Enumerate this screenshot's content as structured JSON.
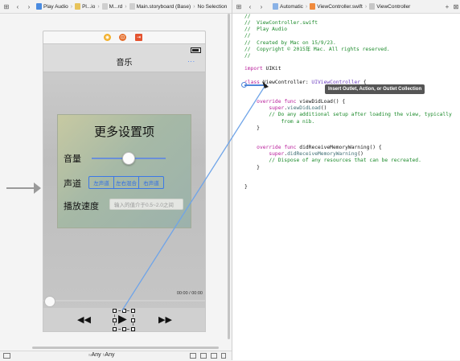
{
  "left_jumpbar": {
    "crumbs": [
      "Play Audio",
      "Pl...io",
      "M...rd",
      "Main.storyboard (Base)",
      "No Selection"
    ]
  },
  "right_jumpbar": {
    "crumbs": [
      "Automatic",
      "ViewController.swift",
      "ViewController"
    ]
  },
  "scene": {
    "nav_title": "音乐",
    "nav_more": "...",
    "panel_title": "更多设置项",
    "volume_label": "音量",
    "volume_level": 0.55,
    "channel_label": "声道",
    "channel_segments": [
      "左声道",
      "左右混合",
      "右声道"
    ],
    "speed_label": "播放速度",
    "speed_placeholder": "输入的值介于0.5~2.0之间",
    "time": "00:00 / 00:00",
    "progress": 0.0,
    "rewind": "◀◀",
    "play": "▶",
    "forward": "▶▶"
  },
  "bottom_bar": {
    "size_class_w": "w",
    "size_class_w_value": "Any",
    "size_class_h": "h",
    "size_class_h_value": "Any"
  },
  "tooltip": "Insert Outlet, Action, or Outlet Collection",
  "code_lines": [
    [
      {
        "t": "//",
        "c": "comment"
      }
    ],
    [
      {
        "t": "//  ViewController.swift",
        "c": "comment"
      }
    ],
    [
      {
        "t": "//  Play Audio",
        "c": "comment"
      }
    ],
    [
      {
        "t": "//",
        "c": "comment"
      }
    ],
    [
      {
        "t": "//  Created by Mac on 15/9/23.",
        "c": "comment"
      }
    ],
    [
      {
        "t": "//  Copyright © 2015年 Mac. All rights reserved.",
        "c": "comment"
      }
    ],
    [
      {
        "t": "//",
        "c": "comment"
      }
    ],
    [
      {
        "t": "",
        "c": "plain"
      }
    ],
    [
      {
        "t": "import",
        "c": "kw"
      },
      {
        "t": " UIKit",
        "c": "plain"
      }
    ],
    [
      {
        "t": "",
        "c": "plain"
      }
    ],
    [
      {
        "t": "class",
        "c": "kw"
      },
      {
        "t": " ViewController: ",
        "c": "plain"
      },
      {
        "t": "UIViewController",
        "c": "type"
      },
      {
        "t": " {",
        "c": "plain"
      }
    ],
    [
      {
        "t": "",
        "c": "plain"
      }
    ],
    [
      {
        "t": "",
        "c": "plain"
      }
    ],
    [
      {
        "t": "    ",
        "c": "plain"
      },
      {
        "t": "override",
        "c": "kw"
      },
      {
        "t": " ",
        "c": "plain"
      },
      {
        "t": "func",
        "c": "kw"
      },
      {
        "t": " viewDidLoad() {",
        "c": "plain"
      }
    ],
    [
      {
        "t": "        ",
        "c": "plain"
      },
      {
        "t": "super",
        "c": "kw"
      },
      {
        "t": ".",
        "c": "plain"
      },
      {
        "t": "viewDidLoad",
        "c": "call"
      },
      {
        "t": "()",
        "c": "plain"
      }
    ],
    [
      {
        "t": "        // Do any additional setup after loading the view, typically",
        "c": "comment"
      }
    ],
    [
      {
        "t": "            from a nib.",
        "c": "comment"
      }
    ],
    [
      {
        "t": "    }",
        "c": "plain"
      }
    ],
    [
      {
        "t": "",
        "c": "plain"
      }
    ],
    [
      {
        "t": "",
        "c": "plain"
      }
    ],
    [
      {
        "t": "    ",
        "c": "plain"
      },
      {
        "t": "override",
        "c": "kw"
      },
      {
        "t": " ",
        "c": "plain"
      },
      {
        "t": "func",
        "c": "kw"
      },
      {
        "t": " didReceiveMemoryWarning() {",
        "c": "plain"
      }
    ],
    [
      {
        "t": "        ",
        "c": "plain"
      },
      {
        "t": "super",
        "c": "kw"
      },
      {
        "t": ".",
        "c": "plain"
      },
      {
        "t": "didReceiveMemoryWarning",
        "c": "call"
      },
      {
        "t": "()",
        "c": "plain"
      }
    ],
    [
      {
        "t": "        // Dispose of any resources that can be recreated.",
        "c": "comment"
      }
    ],
    [
      {
        "t": "    }",
        "c": "plain"
      }
    ],
    [
      {
        "t": "",
        "c": "plain"
      }
    ],
    [
      {
        "t": "",
        "c": "plain"
      }
    ],
    [
      {
        "t": "}",
        "c": "plain"
      }
    ]
  ],
  "colors": {
    "accent": "#2f73ff",
    "connection_line": "#4f86d9"
  },
  "icons": [
    "grid-icon",
    "back-arrow-icon",
    "forward-arrow-icon",
    "folder-icon",
    "storyboard-icon",
    "swift-file-icon",
    "plus-icon",
    "add-tab-icon"
  ]
}
